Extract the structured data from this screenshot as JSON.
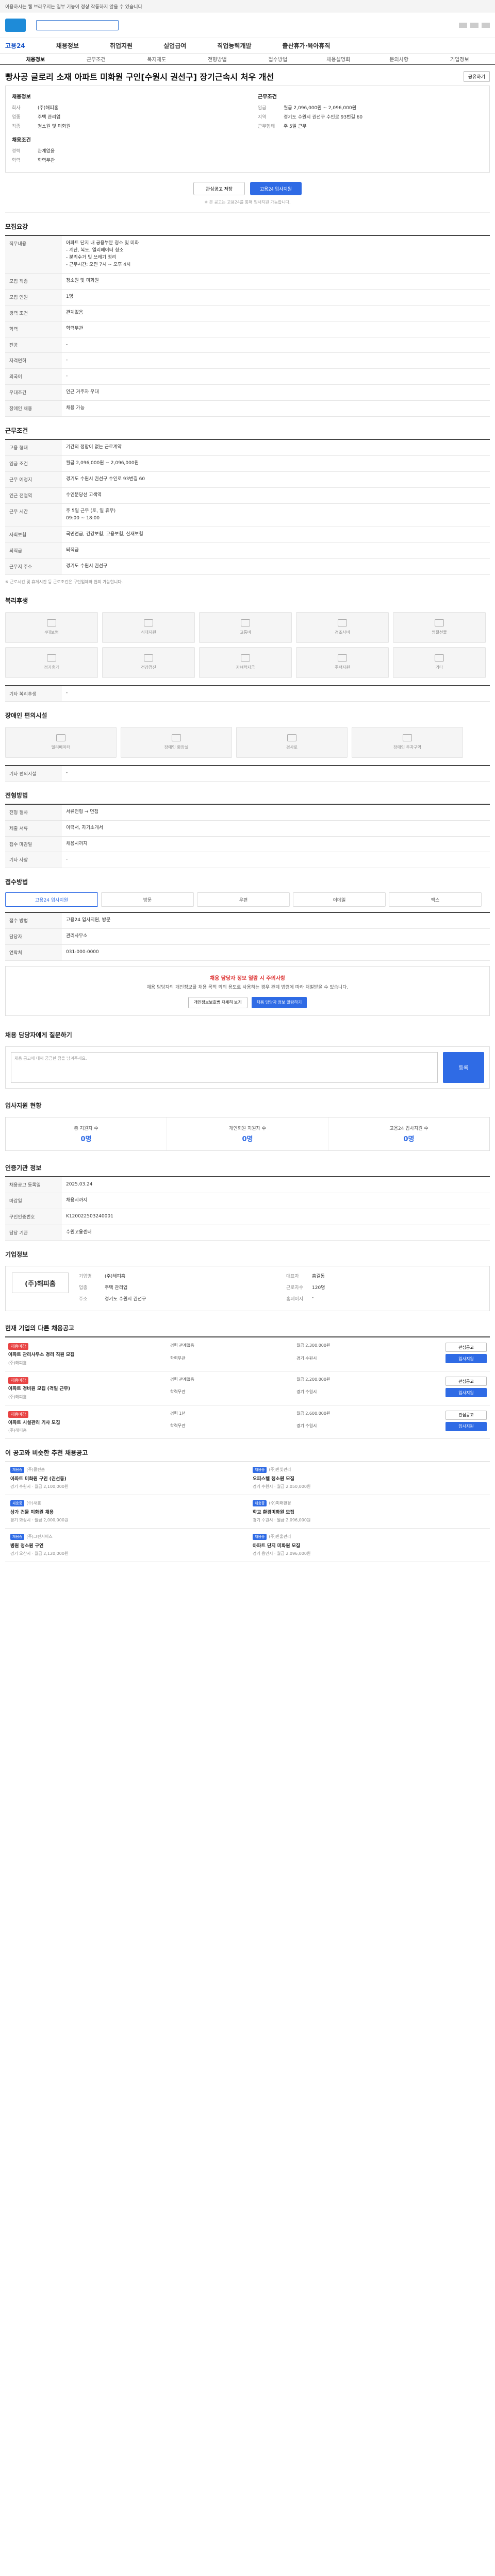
{
  "topbar": {
    "text": "이용하시는 웹 브라우저는 일부 기능이 정상 작동하지 않을 수 있습니다"
  },
  "gnb": [
    "고용24",
    "채용정보",
    "취업지원",
    "실업급여",
    "직업능력개발",
    "출산휴가·육아휴직"
  ],
  "tabs": [
    "채용정보",
    "근무조건",
    "복지제도",
    "전형방법",
    "접수방법",
    "채용설명회",
    "문의사항",
    "기업정보"
  ],
  "job": {
    "title": "빵사공 글로리 소재 아파트 미화원 구인[수원시 권선구] 장기근속시 처우 개선",
    "share": "공유하기",
    "company_label": "채용정보",
    "company_rows": [
      {
        "k": "회사",
        "v": "(주)해피홈"
      },
      {
        "k": "업종",
        "v": "주택 관리업"
      },
      {
        "k": "직종",
        "v": "청소원 및 미화원"
      }
    ],
    "work_label": "근무조건",
    "work_rows": [
      {
        "k": "임금",
        "v": "월급 2,096,000원 ~ 2,096,000원"
      },
      {
        "k": "지역",
        "v": "경기도 수원시 권선구 수인로 93번길 60"
      },
      {
        "k": "근무형태",
        "v": "주 5일 근무"
      }
    ],
    "condition_label": "채용조건",
    "condition_rows": [
      {
        "k": "경력",
        "v": "관계없음"
      },
      {
        "k": "학력",
        "v": "학력무관"
      }
    ],
    "interest_btn": "관심공고 저장",
    "apply_btn": "고용24 입사지원",
    "notice": "※ 본 공고는 고용24를 통해 입사지원 가능합니다."
  },
  "recruit": {
    "section": "모집요강",
    "rows": [
      {
        "k": "직무내용",
        "v": "아파트 단지 내 공용부분 청소 및 미화\n- 계단, 복도, 엘리베이터 청소\n- 분리수거 및 쓰레기 정리\n- 근무시간: 오전 7시 ~ 오후 4시"
      },
      {
        "k": "모집 직종",
        "v": "청소원 및 미화원"
      },
      {
        "k": "모집 인원",
        "v": "1명"
      },
      {
        "k": "경력 조건",
        "v": "관계없음"
      },
      {
        "k": "학력",
        "v": "학력무관"
      },
      {
        "k": "전공",
        "v": "-"
      },
      {
        "k": "자격면허",
        "v": "-"
      },
      {
        "k": "외국어",
        "v": "-"
      },
      {
        "k": "우대조건",
        "v": "인근 거주자 우대"
      },
      {
        "k": "장애인 채용",
        "v": "채용 가능"
      }
    ]
  },
  "work": {
    "section": "근무조건",
    "rows": [
      {
        "k": "고용 형태",
        "v": "기간의 정함이 없는 근로계약"
      },
      {
        "k": "임금 조건",
        "v": "월급 2,096,000원 ~ 2,096,000원"
      },
      {
        "k": "근무 예정지",
        "v": "경기도 수원시 권선구 수인로 93번길 60"
      },
      {
        "k": "인근 전철역",
        "v": "수인분당선 고색역"
      },
      {
        "k": "근무 시간",
        "v": "주 5일 근무 (토, 일 휴무)\n09:00 ~ 18:00"
      },
      {
        "k": "사회보험",
        "v": "국민연금, 건강보험, 고용보험, 산재보험"
      },
      {
        "k": "퇴직금",
        "v": "퇴직금"
      },
      {
        "k": "근무지 주소",
        "v": "경기도 수원시 권선구"
      }
    ],
    "note": "※ 근로시간 및 휴게시간 등 근로조건은 구인업체와 협의 가능합니다."
  },
  "welfare": {
    "section": "복리후생",
    "cards": [
      "4대보험",
      "식대지원",
      "교통비",
      "경조사비",
      "명절선물",
      "정기휴가",
      "건강검진",
      "자녀학자금",
      "주택지원",
      "기타"
    ],
    "etc_label": "기타 복리후생",
    "etc_value": "-"
  },
  "disabled": {
    "section": "장애인 편의시설",
    "cards": [
      "엘리베이터",
      "장애인 화장실",
      "경사로",
      "장애인 주차구역"
    ],
    "etc_label": "기타 편의시설",
    "etc_value": "-"
  },
  "process": {
    "section": "전형방법",
    "rows": [
      {
        "k": "전형 절차",
        "v": "서류전형 → 면접"
      },
      {
        "k": "제출 서류",
        "v": "이력서, 자기소개서"
      },
      {
        "k": "접수 마감일",
        "v": "채용시까지"
      },
      {
        "k": "기타 사항",
        "v": "-"
      }
    ]
  },
  "apply": {
    "section": "접수방법",
    "methods": [
      "고용24 입사지원",
      "방문",
      "우편",
      "이메일",
      "팩스"
    ],
    "rows": [
      {
        "k": "접수 방법",
        "v": "고용24 입사지원, 방문"
      },
      {
        "k": "담당자",
        "v": "관리사무소"
      },
      {
        "k": "연락처",
        "v": "031-000-0000"
      }
    ]
  },
  "warning": {
    "title": "채용 담당자 정보 열람 시 주의사항",
    "text": "채용 담당자의 개인정보를 채용 목적 외의 용도로 사용하는 경우 관계 법령에 따라 처벌받을 수 있습니다.",
    "btn1": "개인정보보호법 자세히 보기",
    "btn2": "채용 담당자 정보 열람하기"
  },
  "qa": {
    "section": "채용 담당자에게 질문하기",
    "placeholder": "채용 공고에 대해 궁금한 점을 남겨주세요.",
    "send": "등록"
  },
  "stats": {
    "section": "입사지원 현황",
    "items": [
      {
        "label": "총 지원자 수",
        "value": "0명"
      },
      {
        "label": "개인회원 지원자 수",
        "value": "0명"
      },
      {
        "label": "고용24 입사지원 수",
        "value": "0명"
      }
    ]
  },
  "reg": {
    "section": "인증기관 정보",
    "rows": [
      {
        "k": "채용공고 등록일",
        "v": "2025.03.24"
      },
      {
        "k": "마감일",
        "v": "채용시까지"
      },
      {
        "k": "구인인증번호",
        "v": "K120022503240001"
      },
      {
        "k": "담당 기관",
        "v": "수원고용센터"
      }
    ]
  },
  "company": {
    "section": "기업정보",
    "logo": "(주)해피홈",
    "rows": [
      {
        "k": "기업명",
        "v": "(주)해피홈"
      },
      {
        "k": "대표자",
        "v": "홍길동"
      },
      {
        "k": "업종",
        "v": "주택 관리업"
      },
      {
        "k": "근로자수",
        "v": "120명"
      },
      {
        "k": "주소",
        "v": "경기도 수원시 권선구"
      },
      {
        "k": "홈페이지",
        "v": "-"
      }
    ]
  },
  "other_jobs": {
    "section": "현재 기업의 다른 채용공고",
    "items": [
      {
        "badge": "채용마감",
        "title": "아파트 관리사무소 경리 직원 모집",
        "company": "(주)해피홈",
        "m": [
          "경력 관계없음",
          "월급 2,300,000원",
          "학력무관",
          "경기 수원시"
        ]
      },
      {
        "badge": "채용마감",
        "title": "아파트 경비원 모집 (격일 근무)",
        "company": "(주)해피홈",
        "m": [
          "경력 관계없음",
          "월급 2,200,000원",
          "학력무관",
          "경기 수원시"
        ]
      },
      {
        "badge": "채용마감",
        "title": "아파트 시설관리 기사 모집",
        "company": "(주)해피홈",
        "m": [
          "경력 1년",
          "월급 2,600,000원",
          "학력무관",
          "경기 수원시"
        ]
      }
    ],
    "btn_interest": "관심공고",
    "btn_apply": "입사지원"
  },
  "recommend": {
    "section": "이 공고와 비슷한 추천 채용공고",
    "items": [
      {
        "badge": "채용중",
        "title": "아파트 미화원 구인 (권선동)",
        "company": "(주)클린홈",
        "meta": "경기 수원시 · 월급 2,100,000원"
      },
      {
        "badge": "채용중",
        "title": "오피스텔 청소원 모집",
        "company": "(주)한빛관리",
        "meta": "경기 수원시 · 월급 2,050,000원"
      },
      {
        "badge": "채용중",
        "title": "상가 건물 미화원 채용",
        "company": "(주)새롬",
        "meta": "경기 화성시 · 월급 2,000,000원"
      },
      {
        "badge": "채용중",
        "title": "학교 환경미화원 모집",
        "company": "(주)미래환경",
        "meta": "경기 수원시 · 월급 2,096,000원"
      },
      {
        "badge": "채용중",
        "title": "병원 청소원 구인",
        "company": "(주)그린서비스",
        "meta": "경기 오산시 · 월급 2,120,000원"
      },
      {
        "badge": "채용중",
        "title": "아파트 단지 미화원 모집",
        "company": "(주)한울관리",
        "meta": "경기 용인시 · 월급 2,096,000원"
      }
    ]
  }
}
